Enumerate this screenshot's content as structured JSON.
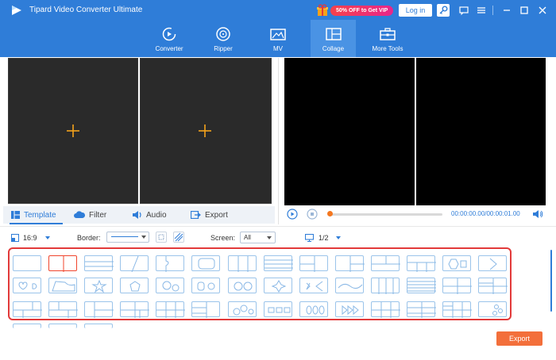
{
  "app": {
    "title": "Tipard Video Converter Ultimate",
    "promo_text": "50% OFF to Get VIP",
    "login_label": "Log in"
  },
  "nav": [
    {
      "label": "Converter",
      "icon": "converter-icon"
    },
    {
      "label": "Ripper",
      "icon": "ripper-icon"
    },
    {
      "label": "MV",
      "icon": "mv-icon"
    },
    {
      "label": "Collage",
      "icon": "collage-icon",
      "active": true
    },
    {
      "label": "More Tools",
      "icon": "toolbox-icon"
    }
  ],
  "tabs": [
    {
      "label": "Template",
      "active": true
    },
    {
      "label": "Filter"
    },
    {
      "label": "Audio"
    },
    {
      "label": "Export"
    }
  ],
  "player": {
    "time": "00:00:00.00/00:00:01.00",
    "progress": 0.0
  },
  "toolbar": {
    "ratio": "16:9",
    "border_label": "Border:",
    "screen_label": "Screen:",
    "screen_value": "All",
    "page": "1/2"
  },
  "export_label": "Export",
  "colors": {
    "header": "#2f7dd8",
    "accent_orange": "#f4771f",
    "export_button": "#f36f3b",
    "highlight_frame": "#e23a3a"
  }
}
